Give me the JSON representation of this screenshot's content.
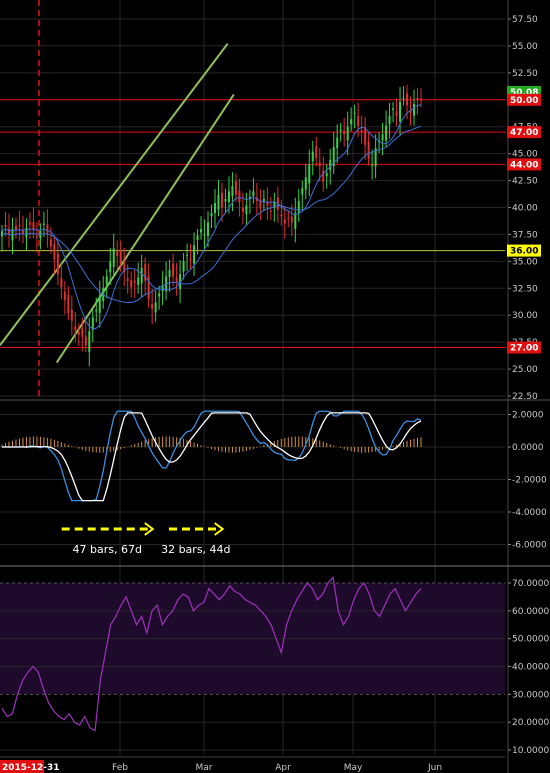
{
  "chart_data": [
    {
      "panel": "price",
      "type": "candlestick",
      "x_axis": {
        "months": [
          "Feb",
          "Mar",
          "Apr",
          "May",
          "Jun"
        ],
        "start_date_label": "2015-12-31"
      },
      "y_axis": {
        "ylim": [
          22.5,
          60
        ],
        "ticks": [
          "57.50",
          "55.00",
          "52.50",
          "50.00",
          "47.50",
          "45.00",
          "42.50",
          "40.00",
          "37.50",
          "35.00",
          "32.50",
          "30.00",
          "27.50",
          "25.00",
          "22.50"
        ]
      },
      "close_series": [
        37.8,
        38.2,
        37.5,
        38.0,
        37.9,
        38.3,
        37.6,
        38.1,
        38.4,
        37.9,
        37.2,
        37.8,
        38.5,
        37.6,
        36.4,
        35.2,
        33.8,
        32.6,
        31.4,
        30.2,
        29.5,
        28.6,
        28.2,
        28.0,
        27.2,
        28.5,
        29.8,
        30.5,
        31.8,
        32.5,
        33.6,
        35.0,
        36.2,
        35.5,
        34.8,
        34.0,
        33.2,
        32.6,
        33.0,
        33.5,
        34.4,
        33.2,
        31.5,
        30.6,
        31.2,
        32.0,
        32.8,
        33.6,
        34.2,
        33.6,
        33.0,
        33.8,
        35.0,
        35.6,
        35.2,
        36.5,
        37.4,
        38.0,
        37.5,
        38.6,
        39.5,
        40.4,
        41.2,
        40.0,
        40.8,
        41.5,
        42.0,
        41.2,
        40.5,
        39.6,
        40.2,
        41.0,
        41.5,
        40.6,
        40.0,
        40.8,
        40.2,
        39.6,
        40.5,
        39.8,
        39.2,
        38.5,
        39.0,
        38.6,
        39.5,
        40.6,
        41.8,
        42.8,
        44.0,
        45.2,
        44.6,
        43.8,
        42.4,
        43.2,
        44.4,
        45.6,
        46.5,
        47.2,
        46.8,
        47.5,
        48.2,
        48.8,
        47.6,
        47.0,
        45.8,
        44.5,
        44.0,
        45.5,
        46.2,
        46.8,
        47.6,
        48.5,
        49.2,
        48.5,
        49.8,
        50.2,
        49.5,
        48.8,
        49.6,
        50.0,
        50.08
      ],
      "channels": [
        {
          "name": "upper",
          "color": "#8fbf5a",
          "start": [
            "2015-12-31",
            30.0
          ],
          "end": [
            "2016-05-31",
            55.2
          ]
        },
        {
          "name": "lower",
          "color": "#8fbf5a",
          "start": [
            "2016-01-15",
            25.6
          ],
          "end": [
            "2016-06-05",
            50.5
          ]
        }
      ],
      "horizontal_levels": [
        {
          "value": 50.08,
          "label": "50.08",
          "line_color": null,
          "badge_bg": "#22aa22",
          "badge_fg": "#ffffff",
          "kind": "last-price"
        },
        {
          "value": 50.0,
          "label": "50.00",
          "line_color": "#e01010",
          "badge_bg": "#e01010",
          "badge_fg": "#ffffff",
          "kind": "level"
        },
        {
          "value": 47.0,
          "label": "47.00",
          "line_color": "#e01010",
          "badge_bg": "#e01010",
          "badge_fg": "#ffffff",
          "kind": "level"
        },
        {
          "value": 44.0,
          "label": "44.00",
          "line_color": "#e01010",
          "badge_bg": "#e01010",
          "badge_fg": "#ffffff",
          "kind": "level"
        },
        {
          "value": 36.0,
          "label": "36.00",
          "line_color": "#b6c43a",
          "badge_bg": "#ffff00",
          "badge_fg": "#000000",
          "kind": "level"
        },
        {
          "value": 27.0,
          "label": "27.00",
          "line_color": "#e01010",
          "badge_bg": "#e01010",
          "badge_fg": "#ffffff",
          "kind": "level"
        }
      ],
      "moving_average_color": "#3a6fd6",
      "colors": {
        "up": "#3bd04a",
        "down": "#e03030",
        "grid": "#3a3a3a"
      }
    },
    {
      "panel": "macd",
      "type": "line",
      "y_axis": {
        "ylim": [
          -7,
          3
        ],
        "ticks": [
          "2.0000",
          "0.0000",
          "-2.0000",
          "-4.0000",
          "-6.0000"
        ]
      },
      "series": [
        {
          "color": "#3a8fe0",
          "key": "macd"
        },
        {
          "color": "#ffffff",
          "key": "signal"
        }
      ],
      "histogram_color": "#d6923a",
      "annotations": [
        {
          "text": "47 bars, 67d",
          "x_start": "2016-01-19",
          "x_end": "2016-04-01",
          "y": -5.2,
          "text_y": -6.2
        },
        {
          "text": "32 bars, 44d",
          "x_start": "2016-04-14",
          "x_end": "2016-05-27",
          "y": -5.2,
          "text_y": -6.2
        }
      ]
    },
    {
      "panel": "rsi",
      "type": "line",
      "y_axis": {
        "ylim": [
          8,
          75
        ],
        "ticks": [
          "70.0000",
          "60.0000",
          "50.0000",
          "40.0000",
          "30.0000",
          "20.0000",
          "10.0000"
        ]
      },
      "series": [
        {
          "color": "#a030c0",
          "key": "rsi",
          "values": [
            25,
            22,
            23,
            30,
            35,
            38,
            40,
            38,
            32,
            27,
            24,
            22,
            21,
            23,
            20,
            19,
            22,
            18,
            17,
            35,
            45,
            55,
            58,
            62,
            65,
            60,
            55,
            58,
            52,
            60,
            62,
            55,
            58,
            60,
            64,
            66,
            65,
            60,
            62,
            63,
            68,
            66,
            64,
            66,
            69,
            67,
            66,
            64,
            63,
            62,
            60,
            58,
            55,
            50,
            45,
            55,
            60,
            64,
            67,
            70,
            68,
            64,
            66,
            70,
            72,
            60,
            55,
            58,
            64,
            68,
            70,
            66,
            60,
            58,
            62,
            66,
            68,
            64,
            60,
            63,
            66,
            68
          ]
        }
      ],
      "overbought_band": {
        "from": 30,
        "to": 70,
        "color": "#1e0a2a"
      }
    }
  ],
  "layout_labels": {
    "start_badge": "2015-12-31"
  }
}
